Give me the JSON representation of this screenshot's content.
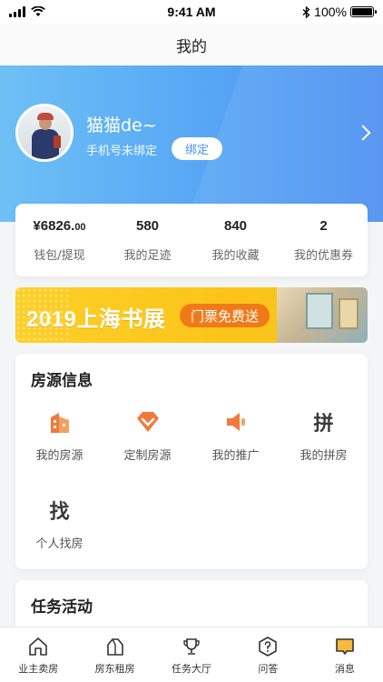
{
  "status_bar": {
    "time": "9:41 AM",
    "battery": "100%"
  },
  "nav": {
    "title": "我的"
  },
  "profile": {
    "name": "猫猫de~",
    "phone_status": "手机号未绑定",
    "bind_label": "绑定"
  },
  "stats": [
    {
      "value_main": "¥6826.",
      "value_small": "00",
      "label": "钱包/提现"
    },
    {
      "value_main": "580",
      "value_small": "",
      "label": "我的足迹"
    },
    {
      "value_main": "840",
      "value_small": "",
      "label": "我的收藏"
    },
    {
      "value_main": "2",
      "value_small": "",
      "label": "我的优惠券"
    }
  ],
  "banner": {
    "title": "2019上海书展",
    "badge": "门票免费送"
  },
  "housing": {
    "title": "房源信息",
    "items": [
      {
        "label": "我的房源",
        "icon": "building-icon"
      },
      {
        "label": "定制房源",
        "icon": "diamond-icon"
      },
      {
        "label": "我的推广",
        "icon": "speaker-icon"
      },
      {
        "label": "我的拼房",
        "icon": "pin-char-icon",
        "glyph": "拼"
      },
      {
        "label": "个人找房",
        "icon": "zhao-char-icon",
        "glyph": "找"
      }
    ]
  },
  "tasks": {
    "title": "任务活动"
  },
  "tabs": [
    {
      "label": "业主卖房",
      "icon": "house-icon"
    },
    {
      "label": "房东租房",
      "icon": "house-outline-icon"
    },
    {
      "label": "任务大厅",
      "icon": "trophy-icon"
    },
    {
      "label": "问答",
      "icon": "question-icon"
    },
    {
      "label": "消息",
      "icon": "message-icon",
      "active": true
    }
  ],
  "colors": {
    "accent_blue": "#4b8ff0",
    "accent_orange": "#f07a3a",
    "banner_yellow": "#fcc419",
    "active_tab": "#f6b93b"
  }
}
